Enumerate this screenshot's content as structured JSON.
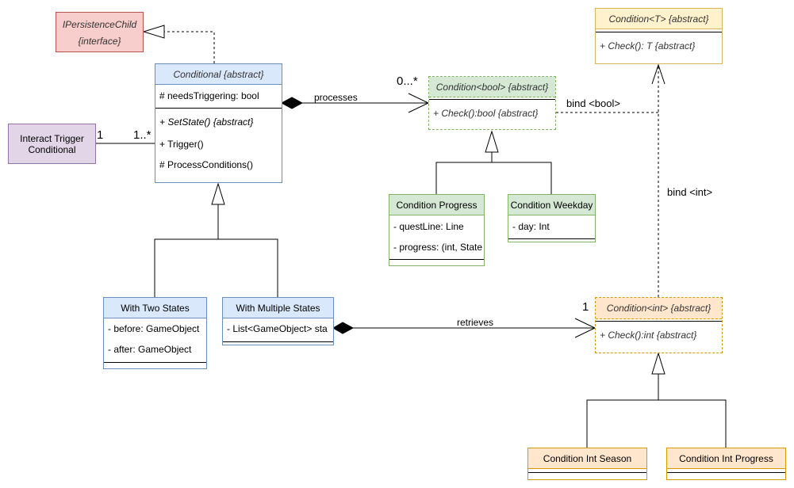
{
  "colors": {
    "blue_fill": "#dae8fc",
    "blue_border": "#6c8ebf",
    "red_fill": "#f8cecc",
    "red_border": "#b85450",
    "purple_fill": "#e1d5e7",
    "purple_border": "#9673a6",
    "green_fill": "#d5e8d4",
    "green_border": "#82b366",
    "yellow_fill": "#fff2cc",
    "yellow_border": "#d6b656",
    "orange_fill": "#ffe6cc",
    "orange_border": "#d79b00"
  },
  "classes": {
    "ipersistence": {
      "name": "IPersistenceChild",
      "stereotype": "{interface}"
    },
    "conditional": {
      "name": "Conditional {abstract}",
      "attributes": [
        "# needsTriggering: bool"
      ],
      "methods": [
        "+ SetState() {abstract}",
        "+ Trigger()",
        "# ProcessConditions()"
      ]
    },
    "interact": {
      "name": "Interact Trigger Conditional"
    },
    "cond_bool": {
      "name": "Condition<bool> {abstract}",
      "methods": [
        "+ Check():bool {abstract}"
      ]
    },
    "cond_progress": {
      "name": "Condition Progress",
      "attributes": [
        "- questLine: Line",
        "- progress: (int, State"
      ]
    },
    "cond_weekday": {
      "name": "Condition Weekday",
      "attributes": [
        "- day: Int"
      ]
    },
    "cond_t": {
      "name": "Condition<T> {abstract}",
      "methods": [
        "+ Check(): T {abstract}"
      ]
    },
    "cond_int": {
      "name": "Condition<int> {abstract}",
      "methods": [
        "+ Check():int {abstract}"
      ]
    },
    "int_season": {
      "name": "Condition Int Season"
    },
    "int_progress": {
      "name": "Condition Int Progress"
    },
    "two_states": {
      "name": "With Two States",
      "attributes": [
        "- before: GameObject",
        "- after: GameObject"
      ]
    },
    "multi_states": {
      "name": "With Multiple States",
      "attributes": [
        "- List<GameObject> sta"
      ]
    }
  },
  "relations": {
    "processes": {
      "label": "processes",
      "target_mult": "0...*"
    },
    "interact_assoc": {
      "source_mult": "1",
      "target_mult": "1..*"
    },
    "bind_bool": {
      "label": "bind <bool>"
    },
    "bind_int": {
      "label": "bind <int>"
    },
    "retrieves": {
      "label": "retrieves",
      "target_mult": "1"
    }
  }
}
